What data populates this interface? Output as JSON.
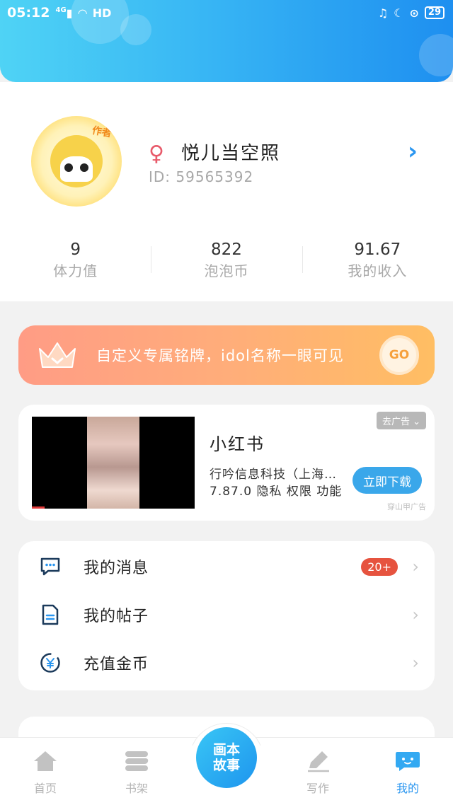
{
  "status_bar": {
    "time": "05:12",
    "network": "4G",
    "hd": "HD",
    "battery": "29"
  },
  "profile": {
    "author_tag": "作者",
    "username": "悦儿当空照",
    "user_id": "ID: 59565392",
    "stats": [
      {
        "value": "9",
        "label": "体力值"
      },
      {
        "value": "822",
        "label": "泡泡币"
      },
      {
        "value": "91.67",
        "label": "我的收入"
      }
    ]
  },
  "promo": {
    "text": "自定义专属铭牌，idol名称一眼可见",
    "go_label": "GO"
  },
  "ad": {
    "tag": "去广告 ⌄",
    "title": "小红书",
    "company": "行吟信息科技（上海…",
    "meta": "7.87.0  隐私  权限  功能",
    "download_label": "立即下载",
    "source": "穿山甲广告"
  },
  "menu": {
    "items": [
      {
        "label": "我的消息",
        "icon": "message-icon",
        "badge": "20+"
      },
      {
        "label": "我的帖子",
        "icon": "document-icon"
      },
      {
        "label": "充值金币",
        "icon": "yen-coin-icon"
      }
    ]
  },
  "bottom_nav": {
    "items": [
      {
        "label": "首页",
        "icon": "home-icon"
      },
      {
        "label": "书架",
        "icon": "bookshelf-icon"
      },
      {
        "label": "写作",
        "icon": "pen-icon"
      },
      {
        "label": "我的",
        "icon": "chat-bubble-icon",
        "active": true
      }
    ],
    "center_line1": "画本",
    "center_line2": "故事"
  },
  "colors": {
    "header_gradient_start": "#4fd3f5",
    "header_gradient_end": "#1e8ff0",
    "accent_blue": "#2a96f0",
    "promo_start": "#ff9c85",
    "promo_end": "#ffbe63",
    "badge_red": "#e6533f",
    "nav_active": "#2a96f0"
  }
}
